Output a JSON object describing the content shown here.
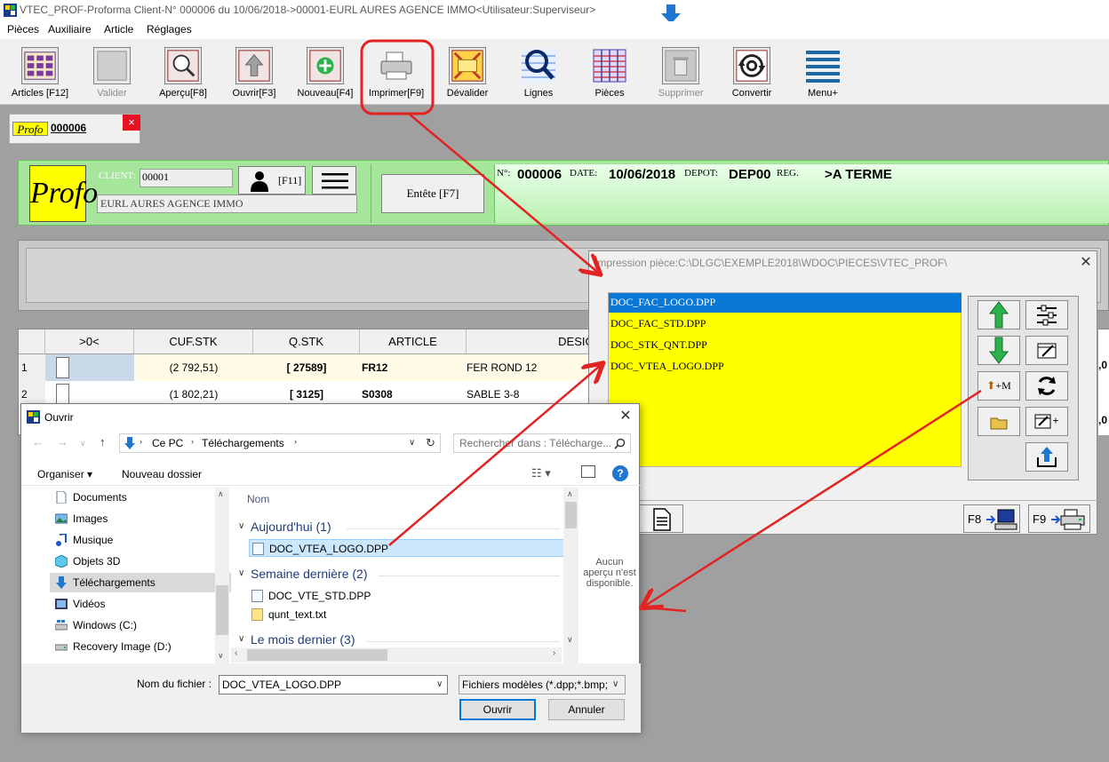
{
  "window": {
    "title": "VTEC_PROF-Proforma Client-N° 000006 du 10/06/2018->00001-EURL AURES AGENCE IMMO<Utilisateur:Superviseur>"
  },
  "menu": [
    "Pièces",
    "Auxiliaire",
    "Article",
    "Réglages"
  ],
  "toolbar": [
    {
      "label": "Articles [F12]",
      "icon": "articles-grid-icon",
      "enabled": true
    },
    {
      "label": "Valider",
      "icon": "validate-icon",
      "enabled": false
    },
    {
      "label": "Aperçu[F8]",
      "icon": "preview-magnifier-icon",
      "enabled": true
    },
    {
      "label": "Ouvrir[F3]",
      "icon": "open-up-arrow-icon",
      "enabled": true
    },
    {
      "label": "Nouveau[F4]",
      "icon": "new-plus-icon",
      "enabled": true
    },
    {
      "label": "Imprimer[F9]",
      "icon": "printer-icon",
      "enabled": true
    },
    {
      "label": "Dévalider",
      "icon": "unvalidate-x-icon",
      "enabled": true
    },
    {
      "label": "Lignes",
      "icon": "lines-magnifier-icon",
      "enabled": true
    },
    {
      "label": "Pièces",
      "icon": "pieces-grid-icon",
      "enabled": true
    },
    {
      "label": "Supprimer",
      "icon": "trash-icon",
      "enabled": false
    },
    {
      "label": "Convertir",
      "icon": "convert-gear-icon",
      "enabled": true
    },
    {
      "label": "Menu+",
      "icon": "menu-lines-icon",
      "enabled": true
    }
  ],
  "doc_tab": {
    "badge": "Profo",
    "number": "000006",
    "close": "×"
  },
  "header": {
    "logo": "Profo",
    "client_label": "CLIENT:",
    "client_code": "00001",
    "client_name": "EURL AURES AGENCE IMMO",
    "person_shortcut": "[F11]",
    "entete_label": "Entête [F7]",
    "info": {
      "n_label": "N°:",
      "n_value": "000006",
      "date_label": "DATE:",
      "date_value": "10/06/2018",
      "depot_label": "DEPOT:",
      "depot_value": "DEP00",
      "reg_label": "REG.",
      "reg_value": ">A TERME"
    }
  },
  "grid": {
    "columns": [
      ">0<",
      "CUF.STK",
      "Q.STK",
      "ARTICLE",
      "DESIGN"
    ],
    "rows": [
      {
        "n": "1",
        "cuf": "(2 792,51)",
        "qstk": "[ 27589]",
        "article": "FR12",
        "design": "FER ROND 12"
      },
      {
        "n": "2",
        "cuf": "(1 802,21)",
        "qstk": "[ 3125]",
        "article": "S0308",
        "design": "SABLE 3-8"
      }
    ],
    "edge_values": [
      ",0",
      ",0"
    ]
  },
  "print_dialog": {
    "title": "Impression pièce:C:\\DLGC\\EXEMPLE2018\\WDOC\\PIECES\\VTEC_PROF\\",
    "close": "✕",
    "files": [
      "DOC_FAC_LOGO.DPP",
      "DOC_FAC_STD.DPP",
      "DOC_STK_QNT.DPP",
      "DOC_VTEA_LOGO.DPP"
    ],
    "selected_index": 0,
    "side_buttons": {
      "up": "move-up-arrow-icon",
      "settings": "settings-sliders-icon",
      "down": "move-down-arrow-icon",
      "edit": "edit-layout-icon",
      "import_label": "+M",
      "refresh": "refresh-icon",
      "folder": "folder-open-icon",
      "new_layout_label": "+",
      "upload": "upload-icon"
    },
    "bottom": {
      "f8": "F8",
      "f9": "F9"
    }
  },
  "open_dialog": {
    "title": "Ouvrir",
    "close": "✕",
    "path": [
      "Ce PC",
      "Téléchargements"
    ],
    "search_placeholder": "Rechercher dans : Télécharge...",
    "organize": "Organiser ▾",
    "new_folder": "Nouveau dossier",
    "sidebar": [
      "Documents",
      "Images",
      "Musique",
      "Objets 3D",
      "Téléchargements",
      "Vidéos",
      "Windows (C:)",
      "Recovery Image (D:)"
    ],
    "sidebar_selected": 4,
    "column_name": "Nom",
    "groups": [
      {
        "label": "Aujourd'hui (1)",
        "files": [
          "DOC_VTEA_LOGO.DPP"
        ]
      },
      {
        "label": "Semaine dernière (2)",
        "files": [
          "DOC_VTE_STD.DPP",
          "qunt_text.txt"
        ]
      },
      {
        "label": "Le mois dernier (3)",
        "files": []
      }
    ],
    "preview_text": [
      "Aucun",
      "aperçu n'est",
      "disponible."
    ],
    "filename_label": "Nom du fichier :",
    "filename_value": "DOC_VTEA_LOGO.DPP",
    "filetype_value": "Fichiers modèles (*.dpp;*.bmp;",
    "open_button": "Ouvrir",
    "cancel_button": "Annuler"
  },
  "colors": {
    "highlight_red": "#e32222",
    "list_yellow": "#ffff00",
    "header_green": "#a5e69a",
    "selection_blue": "#0a78d7"
  }
}
